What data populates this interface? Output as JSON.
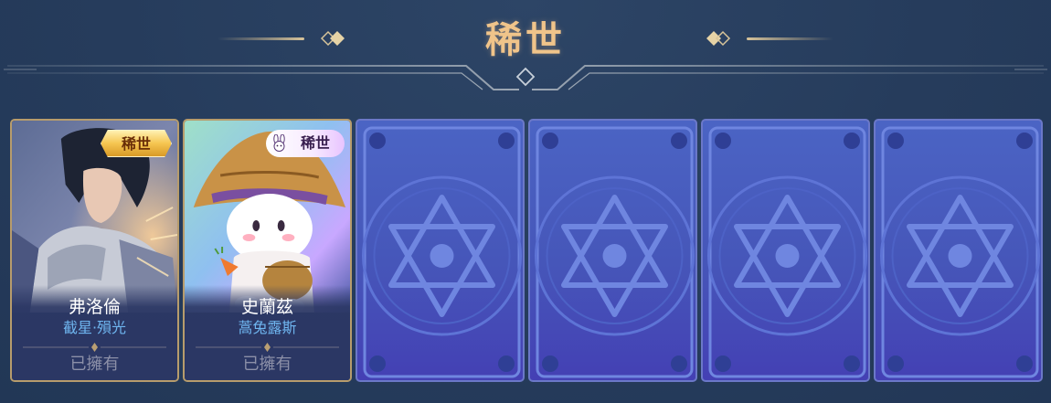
{
  "header": {
    "title": "稀世"
  },
  "colors": {
    "background": "#263c5c",
    "title": "#f0c48a",
    "skin_name": "#6fb6f0",
    "card_back": "#4656b9"
  },
  "cards": [
    {
      "hero": "弗洛倫",
      "skin": "截星·殞光",
      "status": "已擁有",
      "badge": "稀世",
      "art_icon": "hero-portrait-icon"
    },
    {
      "hero": "史蘭茲",
      "skin": "蒿兔露斯",
      "status": "已擁有",
      "badge": "稀世",
      "art_icon": "hero-portrait-icon"
    }
  ],
  "hidden_cards": [
    {
      "icon": "hexagram-icon"
    },
    {
      "icon": "hexagram-icon"
    },
    {
      "icon": "hexagram-icon"
    },
    {
      "icon": "hexagram-icon"
    }
  ]
}
